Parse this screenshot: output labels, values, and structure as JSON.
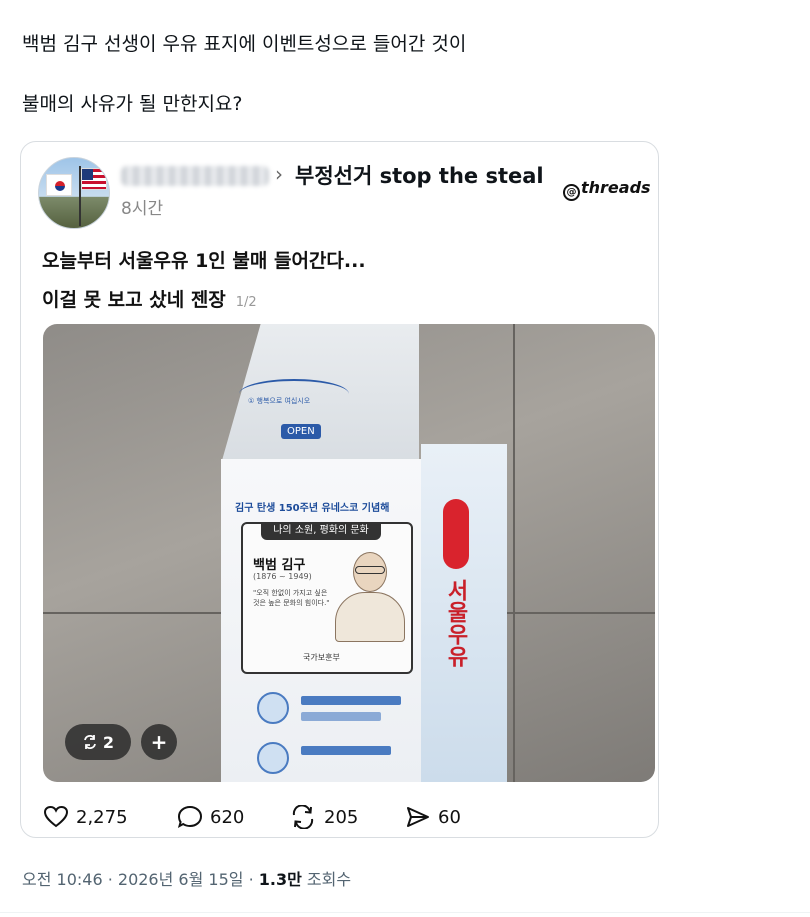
{
  "post": {
    "line1": "백범 김구 선생이 우유 표지에 이벤트성으로 들어간 것이",
    "line2": "불매의 사유가 될 만한지요?"
  },
  "embedded": {
    "community": "부정선거 stop the steal",
    "platform": "threads",
    "time_ago": "8시간",
    "text_line1": "오늘부터 서울우유 1인 불매 들어간다...",
    "text_line2": "이걸 못 보고 샀네 젠장",
    "page_indicator": "1/2",
    "media": {
      "repost_badge_count": "2",
      "plus_label": "+",
      "carton": {
        "open_label": "OPEN",
        "top_slogan": "① 행복으로 여십시오",
        "title": "김구 탄생 150주년 유네스코 기념해",
        "panel_head": "나의 소원, 평화의 문화",
        "name": "백범 김구",
        "years": "(1876 ~ 1949)",
        "quote": "\"오직 한없이 가지고 싶은 것은 높은 문화의 힘이다.\"",
        "seal": "국가보훈부",
        "brand": "서울우유"
      }
    },
    "actions": {
      "likes": "2,275",
      "replies": "620",
      "reposts": "205",
      "shares": "60"
    }
  },
  "meta": {
    "timestamp": "오전 10:46 · 2026년 6월 15일 · ",
    "views_count": "1.3만",
    "views_label": " 조회수"
  }
}
